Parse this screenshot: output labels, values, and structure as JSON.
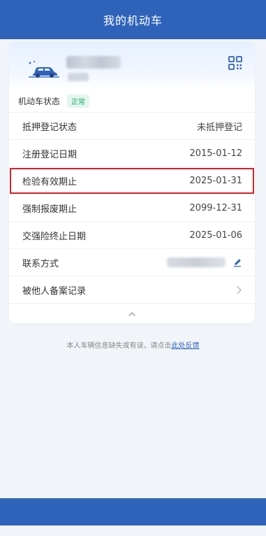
{
  "header": {
    "title": "我的机动车"
  },
  "vehicle": {
    "plate_number": "",
    "icons": {
      "car": "car-icon",
      "qr": "qr-code-icon"
    }
  },
  "status": {
    "label": "机动车状态",
    "value": "正常",
    "color": "#1ea76b"
  },
  "rows": [
    {
      "label": "抵押登记状态",
      "value": "未抵押登记"
    },
    {
      "label": "注册登记日期",
      "value": "2015-01-12"
    },
    {
      "label": "检验有效期止",
      "value": "2025-01-31",
      "highlighted": true
    },
    {
      "label": "强制报废期止",
      "value": "2099-12-31"
    },
    {
      "label": "交强险终止日期",
      "value": "2025-01-06"
    }
  ],
  "contact": {
    "label": "联系方式",
    "edit_icon": "edit-icon"
  },
  "filing": {
    "label": "被他人备案记录"
  },
  "feedback": {
    "text": "本人车辆信息缺失或有误，请点击",
    "link": "此处反馈"
  },
  "colors": {
    "brand": "#2f63ba",
    "highlight_border": "#d2232a"
  }
}
